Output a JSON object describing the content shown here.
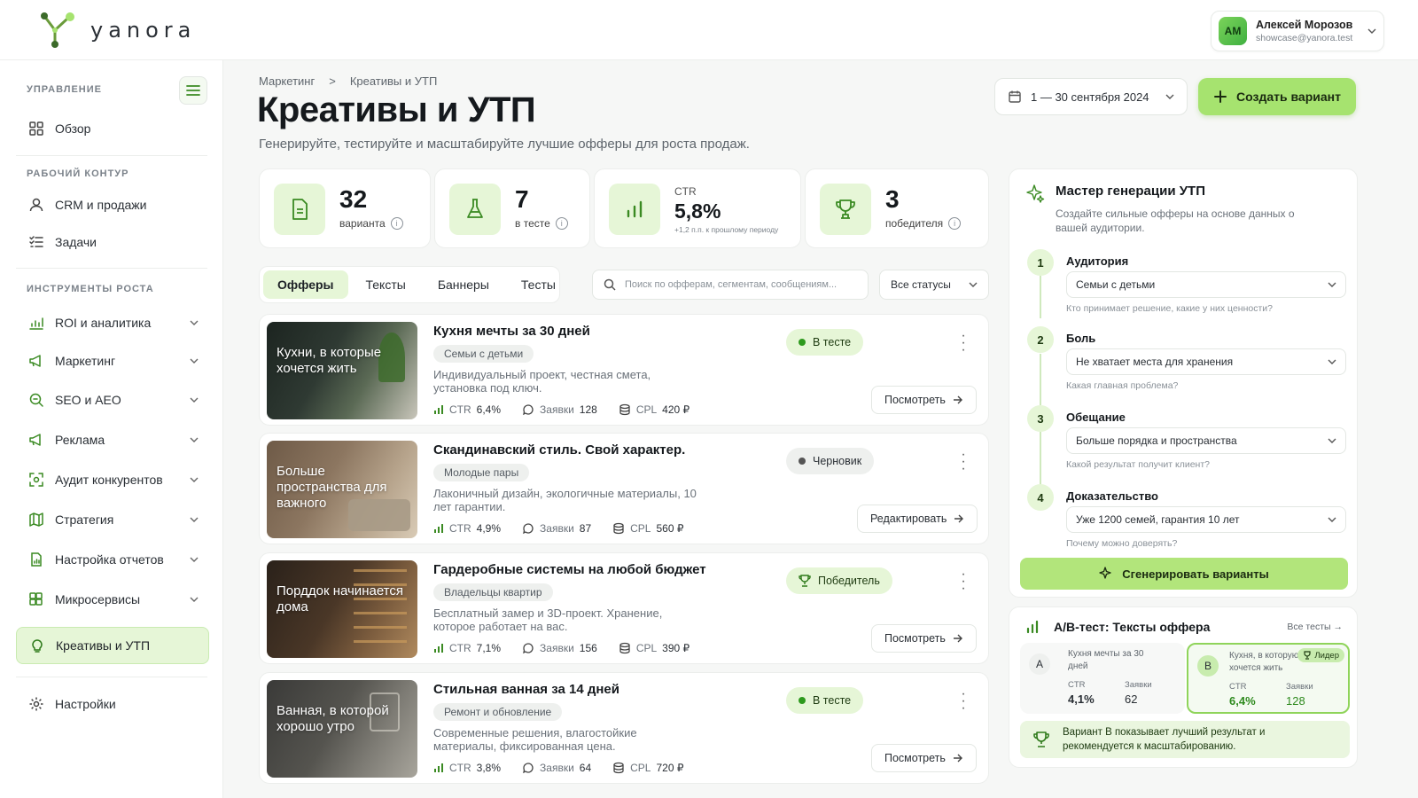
{
  "app": {
    "logo_text": "yanora"
  },
  "user": {
    "initials": "АМ",
    "name": "Алексей Морозов",
    "email": "showcase@yanora.test"
  },
  "sidebar": {
    "sections": [
      "УПРАВЛЕНИЕ",
      "РАБОЧИЙ КОНТУР",
      "ИНСТРУМЕНТЫ РОСТА"
    ],
    "overview": "Обзор",
    "crm": "CRM и продажи",
    "tasks": "Задачи",
    "tools": [
      "ROI и аналитика",
      "Маркетинг",
      "SEO и AEO",
      "Реклама",
      "Аудит конкурентов",
      "Стратегия",
      "Настройка отчетов",
      "Микросервисы"
    ],
    "active": "Креативы и УТП",
    "settings": "Настройки"
  },
  "breadcrumb": [
    "Маркетинг",
    ">",
    "Креативы и УТП"
  ],
  "page": {
    "title": "Креативы и УТП",
    "subtitle": "Генерируйте, тестируйте и масштабируйте лучшие офферы для роста продаж."
  },
  "date_range": "1 — 30 сентября 2024",
  "create_button": "Создать вариант",
  "stats": {
    "variants": {
      "value": "32",
      "label": "варианта"
    },
    "testing": {
      "value": "7",
      "label": "в тесте"
    },
    "ctr": {
      "label": "CTR",
      "value": "5,8%",
      "note": "+1,2 п.п. к прошлому периоду"
    },
    "winners": {
      "value": "3",
      "label": "победителя"
    }
  },
  "tabs": [
    "Офферы",
    "Тексты",
    "Баннеры",
    "Тесты"
  ],
  "search_placeholder": "Поиск по офферам, сегментам, сообщениям...",
  "status_filter": "Все статусы",
  "metric_labels": {
    "ctr": "CTR",
    "leads": "Заявки",
    "cpl": "CPL"
  },
  "offers": [
    {
      "caption": "Кухни, в которые хочется жить",
      "title": "Кухня мечты за 30 дней",
      "segment": "Семьи с детьми",
      "desc": "Индивидуальный проект, честная смета, установка под ключ.",
      "ctr": "6,4%",
      "leads": "128",
      "cpl": "420 ₽",
      "status": "В тесте",
      "action": "Посмотреть"
    },
    {
      "caption": "Больше пространства для важного",
      "title": "Скандинавский стиль. Свой характер.",
      "segment": "Молодые пары",
      "desc": "Лаконичный дизайн, экологичные материалы, 10 лет гарантии.",
      "ctr": "4,9%",
      "leads": "87",
      "cpl": "560 ₽",
      "status": "Черновик",
      "action": "Редактировать"
    },
    {
      "caption": "Порддок начинается дома",
      "title": "Гардеробные системы на любой бюджет",
      "segment": "Владельцы квартир",
      "desc": "Бесплатный замер и 3D-проект. Хранение, которое работает на вас.",
      "ctr": "7,1%",
      "leads": "156",
      "cpl": "390 ₽",
      "status": "Победитель",
      "action": "Посмотреть"
    },
    {
      "caption": "Ванная, в которой хорошо утро",
      "title": "Стильная ванная за 14 дней",
      "segment": "Ремонт и обновление",
      "desc": "Современные решения, влагостойкие материалы, фиксированная цена.",
      "ctr": "3,8%",
      "leads": "64",
      "cpl": "720 ₽",
      "status": "В тесте",
      "action": "Посмотреть"
    }
  ],
  "wizard": {
    "title": "Мастер генерации УТП",
    "subtitle": "Создайте сильные офферы на основе данных о вашей аудитории.",
    "steps": [
      {
        "n": "1",
        "label": "Аудитория",
        "value": "Семьи с детьми",
        "hint": "Кто принимает решение, какие у них ценности?"
      },
      {
        "n": "2",
        "label": "Боль",
        "value": "Не хватает места для хранения",
        "hint": "Какая главная проблема?"
      },
      {
        "n": "3",
        "label": "Обещание",
        "value": "Больше порядка и пространства",
        "hint": "Какой результат получит клиент?"
      },
      {
        "n": "4",
        "label": "Доказательство",
        "value": "Уже 1200 семей, гарантия 10 лет",
        "hint": "Почему можно доверять?"
      }
    ],
    "generate_button": "Сгенерировать варианты"
  },
  "ab_test": {
    "title": "A/B-тест: Тексты оффера",
    "all_link": "Все тесты →",
    "a": {
      "letter": "A",
      "name": "Кухня мечты за 30 дней",
      "ctr": "4,1%",
      "leads": "62"
    },
    "b": {
      "letter": "B",
      "name": "Кухня, в которую хочется жить",
      "ctr": "6,4%",
      "leads": "128",
      "badge": "Лидер"
    },
    "ctr_label": "CTR",
    "leads_label": "Заявки",
    "note": "Вариант B показывает лучший результат и рекомендуется к масштабированию."
  }
}
